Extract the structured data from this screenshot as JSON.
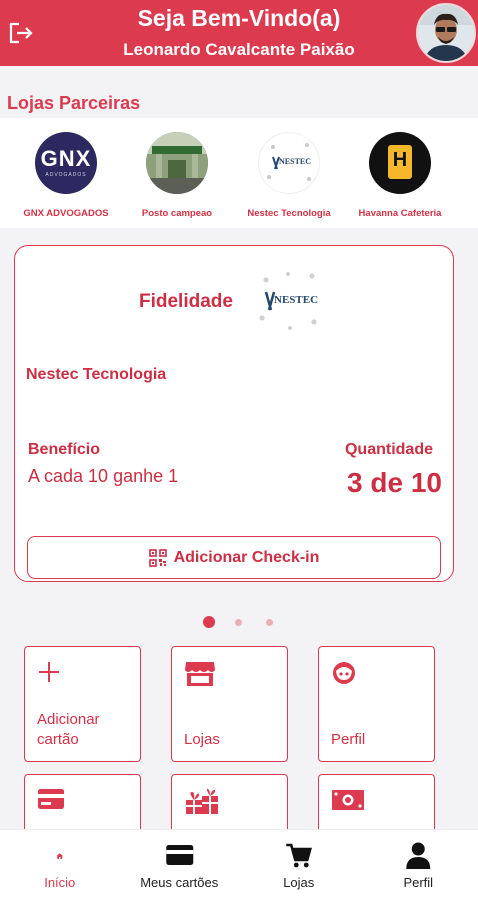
{
  "header": {
    "title": "Seja Bem-Vindo(a)",
    "user_name": "Leonardo Cavalcante Paixão"
  },
  "partners": {
    "title": "Lojas Parceiras",
    "items": [
      {
        "name": "GNX ADVOGADOS",
        "logo_text": "GNX",
        "logo_sub": "ADVOGADOS"
      },
      {
        "name": "Posto campeao"
      },
      {
        "name": "Nestec Tecnologia",
        "logo_text": "NESTEC"
      },
      {
        "name": "Havanna Cafeteria",
        "logo_text": "H"
      }
    ]
  },
  "fidelity_card": {
    "title": "Fidelidade",
    "logo_text": "NESTEC",
    "store_name": "Nestec Tecnologia",
    "benefit_label": "Benefício",
    "benefit_value": "A cada 10 ganhe 1",
    "quantity_label": "Quantidade",
    "quantity_value": "3 de 10",
    "checkin_label": "Adicionar Check-in"
  },
  "carousel": {
    "active_index": 0,
    "count": 3
  },
  "tiles": [
    {
      "label": "Adicionar\ncartão",
      "icon": "plus-icon"
    },
    {
      "label": "Lojas",
      "icon": "store-icon"
    },
    {
      "label": "Perfil",
      "icon": "face-icon"
    },
    {
      "label": "",
      "icon": "credit-card-icon"
    },
    {
      "label": "",
      "icon": "gifts-icon"
    },
    {
      "label": "",
      "icon": "money-icon"
    }
  ],
  "bottom_nav": [
    {
      "label": "Início",
      "icon": "home-icon",
      "active": true
    },
    {
      "label": "Meus cartões",
      "icon": "credit-card-icon",
      "active": false
    },
    {
      "label": "Lojas",
      "icon": "cart-icon",
      "active": false
    },
    {
      "label": "Perfil",
      "icon": "person-icon",
      "active": false
    }
  ],
  "colors": {
    "primary": "#dc3a4e",
    "background": "#f3f3f5"
  }
}
